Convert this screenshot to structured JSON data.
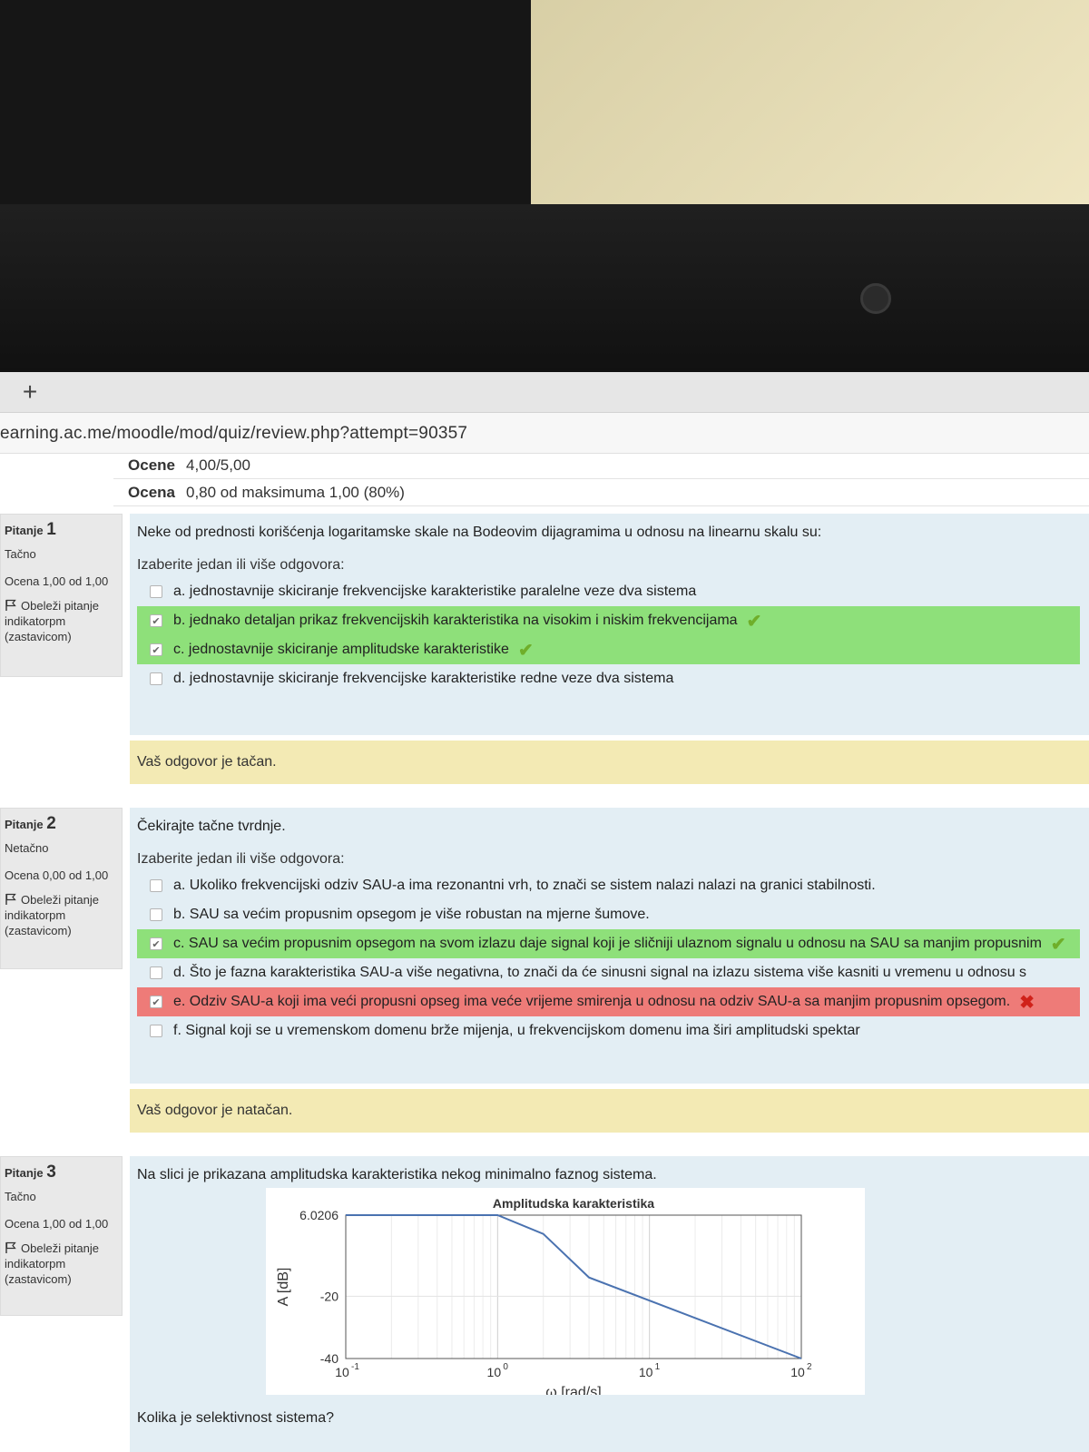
{
  "browser": {
    "new_tab_label": "+",
    "url": "earning.ac.me/moodle/mod/quiz/review.php?attempt=90357"
  },
  "summary": {
    "rows": [
      {
        "label": "Ocene",
        "value": "4,00/5,00"
      },
      {
        "label": "Ocena",
        "value": "0,80 od maksimuma 1,00 (80%)"
      }
    ]
  },
  "questions": [
    {
      "label": "Pitanje",
      "number": "1",
      "state": "Tačno",
      "grade": "Ocena 1,00 od 1,00",
      "flag": "Obeleži pitanje indikatorpm (zastavicom)",
      "text": "Neke od prednosti korišćenja logaritamske skale na Bodeovim dijagramima u odnosu na linearnu skalu su:",
      "prompt": "Izaberite jedan ili više odgovora:",
      "answers": [
        {
          "text": "a. jednostavnije skiciranje frekvencijske karakteristike paralelne veze dva sistema",
          "checked": false,
          "status": "none"
        },
        {
          "text": "b. jednako detaljan prikaz frekvencijskih karakteristika na visokim i niskim frekvencijama",
          "checked": true,
          "status": "correct"
        },
        {
          "text": "c. jednostavnije skiciranje amplitudske karakteristike",
          "checked": true,
          "status": "correct"
        },
        {
          "text": "d. jednostavnije skiciranje frekvencijske karakteristike redne veze dva sistema",
          "checked": false,
          "status": "none"
        }
      ],
      "feedback": "Vaš odgovor je tačan."
    },
    {
      "label": "Pitanje",
      "number": "2",
      "state": "Netačno",
      "grade": "Ocena 0,00 od 1,00",
      "flag": "Obeleži pitanje indikatorpm (zastavicom)",
      "text": "Čekirajte tačne tvrdnje.",
      "prompt": "Izaberite jedan ili više odgovora:",
      "answers": [
        {
          "text": "a. Ukoliko frekvencijski odziv SAU-a ima rezonantni vrh, to znači se sistem nalazi nalazi na granici stabilnosti.",
          "checked": false,
          "status": "none"
        },
        {
          "text": "b. SAU sa većim propusnim opsegom je više robustan na mjerne šumove.",
          "checked": false,
          "status": "none"
        },
        {
          "text": "c. SAU sa većim propusnim opsegom na svom izlazu daje signal koji je sličniji ulaznom signalu  u odnosu na SAU sa manjim propusnim",
          "checked": true,
          "status": "correct"
        },
        {
          "text": "d. Što je fazna karakteristika SAU-a više negativna, to znači da će sinusni signal na izlazu sistema više kasniti u vremenu u odnosu s",
          "checked": false,
          "status": "none"
        },
        {
          "text": "e. Odziv SAU-a koji ima veći propusni opseg ima veće vrijeme smirenja u odnosu na odziv SAU-a sa manjim propusnim opsegom.",
          "checked": true,
          "status": "incorrect"
        },
        {
          "text": "f. Signal koji se u vremenskom domenu brže mijenja, u frekvencijskom domenu ima širi amplitudski spektar",
          "checked": false,
          "status": "none"
        }
      ],
      "feedback": "Vaš odgovor je natačan."
    },
    {
      "label": "Pitanje",
      "number": "3",
      "state": "Tačno",
      "grade": "Ocena 1,00 od 1,00",
      "flag": "Obeleži pitanje indikatorpm (zastavicom)",
      "text": "Na slici je prikazana amplitudska karakteristika nekog minimalno faznog sistema.",
      "followup": "Kolika je selektivnost sistema?"
    }
  ],
  "chart_data": {
    "type": "line",
    "title": "Amplitudska karakteristika",
    "xlabel": "ω [rad/s]",
    "ylabel": "A [dB]",
    "xscale": "log",
    "xlim": [
      0.1,
      100
    ],
    "ylim": [
      -40,
      6.0206
    ],
    "xticks": [
      {
        "value": 0.1,
        "base": "10",
        "exp": "-1"
      },
      {
        "value": 1,
        "base": "10",
        "exp": "0"
      },
      {
        "value": 10,
        "base": "10",
        "exp": "1"
      },
      {
        "value": 100,
        "base": "10",
        "exp": "2"
      }
    ],
    "yticks": [
      {
        "value": 6.0206,
        "label": "6.0206"
      },
      {
        "value": -20,
        "label": "-20"
      },
      {
        "value": -40,
        "label": "-40"
      }
    ],
    "grid": true,
    "series": [
      {
        "color": "#4a72b0",
        "x": [
          0.1,
          1,
          2,
          4,
          100
        ],
        "y": [
          6.0206,
          6.0206,
          0,
          -14,
          -40
        ]
      }
    ]
  },
  "colors": {
    "correct_bg": "#8ee07a",
    "incorrect_bg": "#ee7b78",
    "feedback_bg": "#f3eab4",
    "question_bg": "#e3eef4",
    "series_line": "#4a72b0"
  }
}
